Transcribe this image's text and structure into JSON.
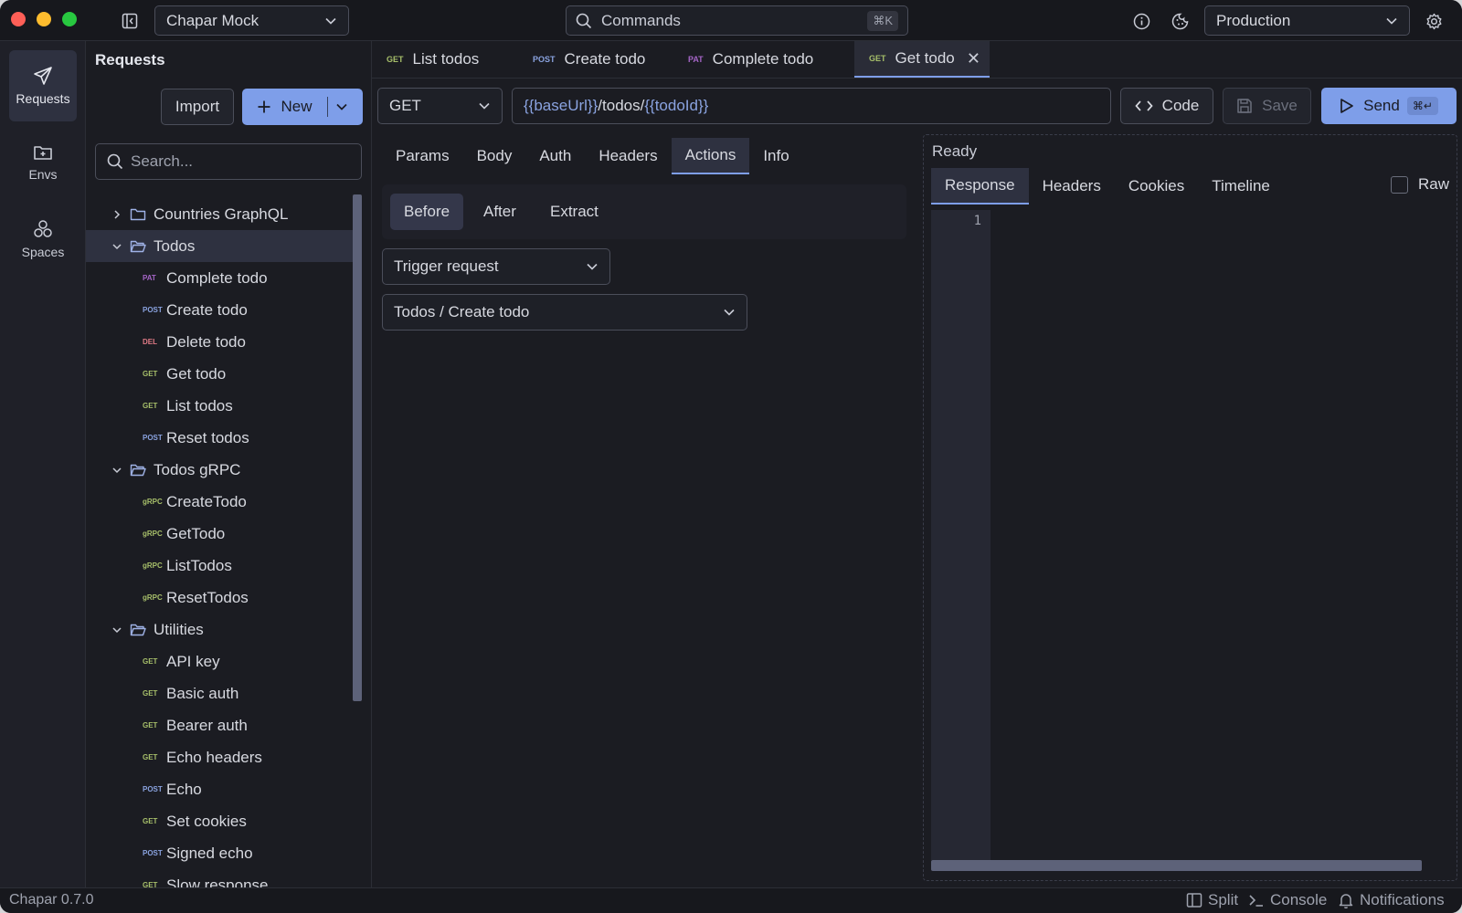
{
  "titlebar": {
    "workspace": "Chapar Mock",
    "commands_label": "Commands",
    "commands_shortcut": "⌘K",
    "environment": "Production"
  },
  "rail": {
    "items": [
      {
        "label": "Requests",
        "icon": "paper-plane-icon",
        "active": true
      },
      {
        "label": "Envs",
        "icon": "folder-plus-icon"
      },
      {
        "label": "Spaces",
        "icon": "cubes-icon"
      }
    ]
  },
  "sidebar": {
    "title": "Requests",
    "import_label": "Import",
    "new_label": "New",
    "search_placeholder": "Search...",
    "tree": [
      {
        "kind": "folder",
        "label": "Countries GraphQL",
        "expanded": false
      },
      {
        "kind": "folder",
        "label": "Todos",
        "expanded": true,
        "selected": true
      },
      {
        "kind": "req",
        "method": "PAT",
        "label": "Complete todo"
      },
      {
        "kind": "req",
        "method": "POST",
        "label": "Create todo"
      },
      {
        "kind": "req",
        "method": "DEL",
        "label": "Delete todo"
      },
      {
        "kind": "req",
        "method": "GET",
        "label": "Get todo"
      },
      {
        "kind": "req",
        "method": "GET",
        "label": "List todos"
      },
      {
        "kind": "req",
        "method": "POST",
        "label": "Reset todos"
      },
      {
        "kind": "folder",
        "label": "Todos gRPC",
        "expanded": true
      },
      {
        "kind": "req",
        "method": "gRPC",
        "label": "CreateTodo"
      },
      {
        "kind": "req",
        "method": "gRPC",
        "label": "GetTodo"
      },
      {
        "kind": "req",
        "method": "gRPC",
        "label": "ListTodos"
      },
      {
        "kind": "req",
        "method": "gRPC",
        "label": "ResetTodos"
      },
      {
        "kind": "folder",
        "label": "Utilities",
        "expanded": true
      },
      {
        "kind": "req",
        "method": "GET",
        "label": "API key"
      },
      {
        "kind": "req",
        "method": "GET",
        "label": "Basic auth"
      },
      {
        "kind": "req",
        "method": "GET",
        "label": "Bearer auth"
      },
      {
        "kind": "req",
        "method": "GET",
        "label": "Echo headers"
      },
      {
        "kind": "req",
        "method": "POST",
        "label": "Echo"
      },
      {
        "kind": "req",
        "method": "GET",
        "label": "Set cookies"
      },
      {
        "kind": "req",
        "method": "POST",
        "label": "Signed echo"
      },
      {
        "kind": "req",
        "method": "GET",
        "label": "Slow response"
      }
    ]
  },
  "tabs": [
    {
      "method": "GET",
      "label": "List todos"
    },
    {
      "method": "POST",
      "label": "Create todo"
    },
    {
      "method": "PAT",
      "label": "Complete todo"
    },
    {
      "method": "GET",
      "label": "Get todo",
      "active": true
    }
  ],
  "request": {
    "method": "GET",
    "url": {
      "var1": "{{baseUrl}}",
      "path": "/todos/",
      "var2": "{{todoId}}"
    },
    "code_label": "Code",
    "save_label": "Save",
    "send_label": "Send",
    "send_shortcut": "⌘↵",
    "tabs": [
      "Params",
      "Body",
      "Auth",
      "Headers",
      "Actions",
      "Info"
    ],
    "active_tab": "Actions",
    "action_tabs": [
      "Before",
      "After",
      "Extract"
    ],
    "active_action_tab": "Before",
    "action_type": "Trigger request",
    "action_target": "Todos / Create todo"
  },
  "response": {
    "status": "Ready",
    "tabs": [
      "Response",
      "Headers",
      "Cookies",
      "Timeline"
    ],
    "active_tab": "Response",
    "raw_label": "Raw",
    "line_number": "1"
  },
  "statusbar": {
    "version": "Chapar 0.7.0",
    "split_label": "Split",
    "console_label": "Console",
    "notifications_label": "Notifications"
  },
  "colors": {
    "accent": "#7e9ee9",
    "background": "#1b1c22",
    "get": "#a7bf6a",
    "post": "#8aa3e0",
    "patch": "#a565c7",
    "delete": "#e07a86"
  }
}
